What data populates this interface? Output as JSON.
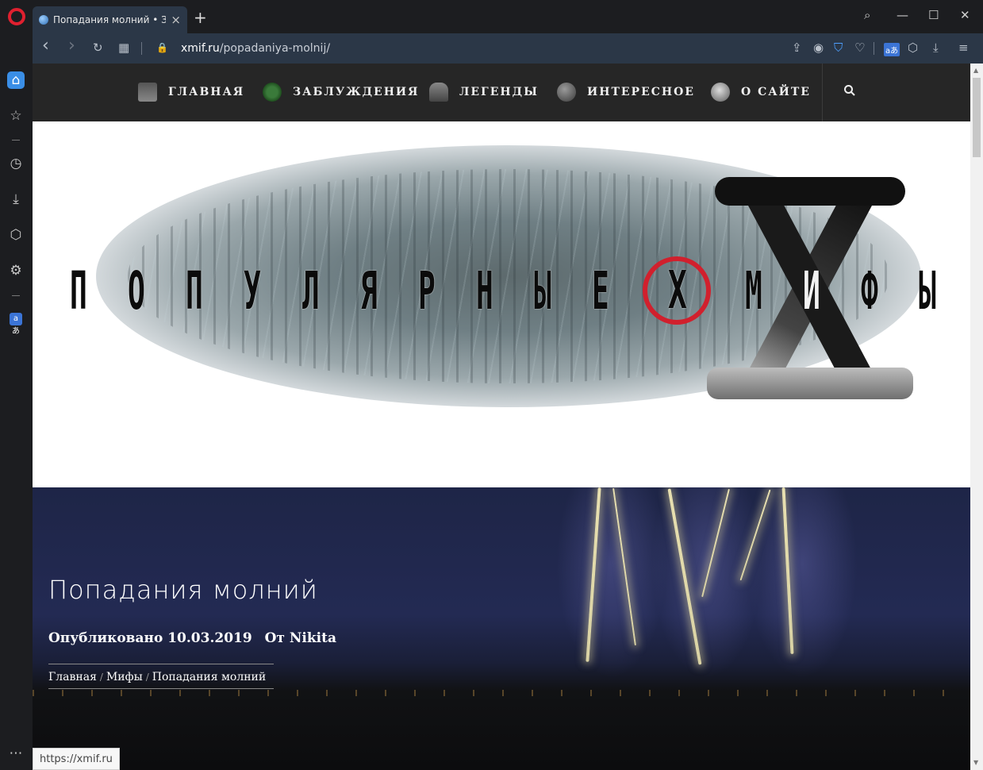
{
  "browser": {
    "tab_title": "Попадания молний • Заблуждения",
    "new_tab": "+",
    "url_host": "xmif.ru",
    "url_path": "/popadaniya-molnij/",
    "status_url": "https://xmif.ru"
  },
  "icons": {
    "tab_close": "×",
    "search": "⌕",
    "minimize": "—",
    "maximize": "☐",
    "close": "✕",
    "back": "‹",
    "forward": "›",
    "reload": "↻",
    "speed_dial": "▦",
    "lock": "🔒",
    "share": "⇪",
    "snapshot": "◉",
    "vpn": "⛉",
    "heart": "♡",
    "extension": "⬡",
    "download": "⤓",
    "menu": "≡",
    "home": "⌂",
    "star": "☆",
    "history": "◷",
    "cube": "⬡",
    "settings": "⚙",
    "more": "⋯",
    "translate": "aあ"
  },
  "site_nav": {
    "items": [
      {
        "label": "ГЛАВНАЯ"
      },
      {
        "label": "ЗАБЛУЖДЕНИЯ"
      },
      {
        "label": "ЛЕГЕНДЫ"
      },
      {
        "label": "ИНТЕРЕСНОЕ"
      },
      {
        "label": "О САЙТЕ"
      }
    ],
    "search_icon": "🔍"
  },
  "banner": {
    "letters": [
      "П",
      "О",
      "П",
      "У",
      "Л",
      "Я",
      "Р",
      "Н",
      "Ы",
      "Е"
    ],
    "ring_letter": "X",
    "letters2": [
      "М",
      "И",
      "Ф",
      "Ы"
    ]
  },
  "article": {
    "title": "Попадания молний",
    "published": "Опубликовано 10.03.2019",
    "author": "От Nikita",
    "breadcrumbs": [
      "Главная",
      "Мифы",
      "Попадания молний"
    ],
    "crumb_sep": "/"
  },
  "colors": {
    "accent_red": "#d1202d",
    "tab_bg": "#2b3747",
    "nav_bg": "#262626"
  }
}
